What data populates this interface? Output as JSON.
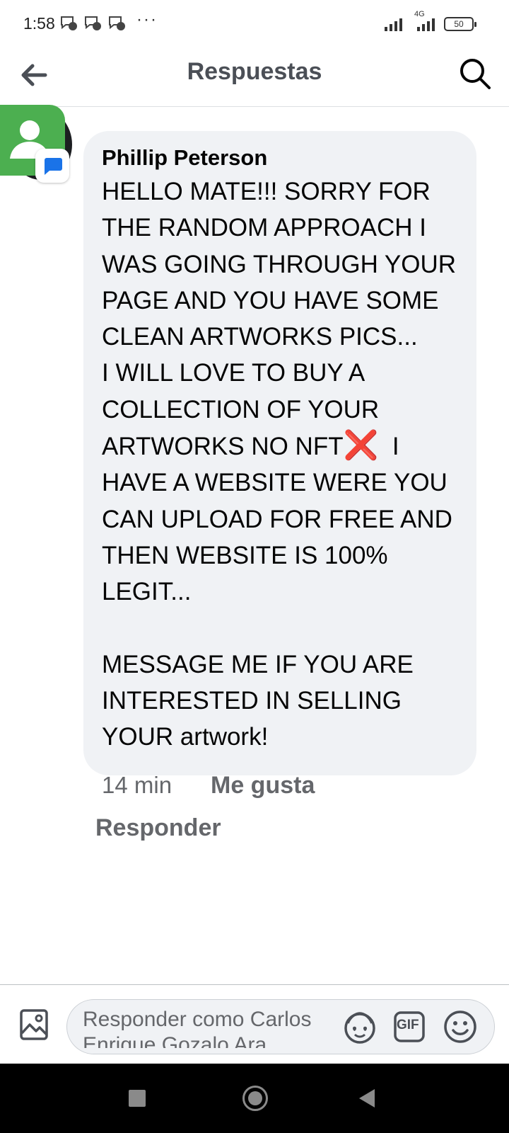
{
  "status_bar": {
    "time": "1:58",
    "dots": "···",
    "network": "4G",
    "battery": "50"
  },
  "header": {
    "title": "Respuestas",
    "back_icon": "arrow-left-icon",
    "search_icon": "search-icon"
  },
  "comment": {
    "author": "Phillip Peterson",
    "body_part1": "HELLO MATE!!! SORRY FOR\nTHE RANDOM APPROACH I\nWAS GOING THROUGH YOUR\nPAGE AND YOU HAVE SOME\nCLEAN ARTWORKS PICS...\nI WILL LOVE TO BUY A\nCOLLECTION OF YOUR\nARTWORKS NO NFT",
    "emoji": "❌",
    "body_part2": "  I\nHAVE A WEBSITE WERE YOU\nCAN UPLOAD FOR FREE AND\nTHEN WEBSITE IS 100%\nLEGIT...\n\nMESSAGE ME IF YOU ARE\nINTERESTED IN SELLING\nYOUR artwork!",
    "time": "14 min",
    "like_label": "Me gusta",
    "reply_label": "Responder"
  },
  "composer": {
    "placeholder": "Responder como Carlos Enrique Gozalo Ara",
    "gif_label": "GIF"
  },
  "colors": {
    "bubble": "#f0f2f5",
    "secondary_text": "#65676b",
    "avatar_app": "#4caf50",
    "badge_icon": "#1a73e8"
  }
}
